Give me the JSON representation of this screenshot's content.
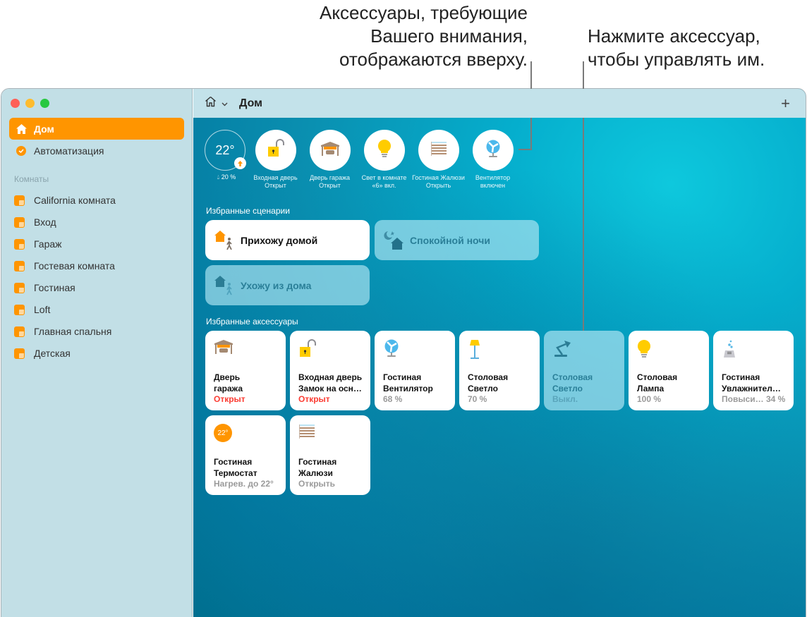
{
  "callouts": {
    "left": [
      "Аксессуары, требующие",
      "Вашего внимания,",
      "отображаются вверху."
    ],
    "right": [
      "Нажмите аксессуар,",
      "чтобы управлять им."
    ]
  },
  "sidebar": {
    "nav": [
      {
        "label": "Дом",
        "icon": "house-icon",
        "active": true
      },
      {
        "label": "Автоматизация",
        "icon": "clock-icon",
        "active": false
      }
    ],
    "rooms_label": "Комнаты",
    "rooms": [
      "California комната",
      "Вход",
      "Гараж",
      "Гостевая комната",
      "Гостиная",
      "Loft",
      "Главная спальня",
      "Детская"
    ]
  },
  "toolbar": {
    "title": "Дом",
    "add_label": "+"
  },
  "status": {
    "temperature": "22°",
    "humidity": "20 %",
    "tiles": [
      {
        "line1": "Входная дверь",
        "line2": "Открыт",
        "icon": "lock-open-icon"
      },
      {
        "line1": "Дверь гаража",
        "line2": "Открыт",
        "icon": "garage-icon"
      },
      {
        "line1": "Свет в комнате",
        "line2": "«6» вкл.",
        "icon": "lightbulb-icon"
      },
      {
        "line1": "Гостиная Жалюзи",
        "line2": "Открыть",
        "icon": "blinds-icon"
      },
      {
        "line1": "Вентилятор",
        "line2": "включен",
        "icon": "fan-icon"
      }
    ]
  },
  "scenes": {
    "heading": "Избранные сценарии",
    "items": [
      {
        "label": "Прихожу домой",
        "on": true
      },
      {
        "label": "Спокойной ночи",
        "on": false
      },
      {
        "label": "Ухожу из дома",
        "on": false
      }
    ]
  },
  "accessories": {
    "heading": "Избранные аксессуары",
    "items": [
      {
        "line1": "Дверь",
        "line2": "гаража",
        "state": "Открыт",
        "alert": true,
        "on": true,
        "icon": "garage-icon"
      },
      {
        "line1": "Входная дверь",
        "line2": "Замок на осн…",
        "state": "Открыт",
        "alert": true,
        "on": true,
        "icon": "lock-open-icon"
      },
      {
        "line1": "Гостиная",
        "line2": "Вентилятор",
        "state": "68 %",
        "alert": false,
        "on": true,
        "icon": "fan-icon"
      },
      {
        "line1": "Столовая",
        "line2": "Светло",
        "state": "70 %",
        "alert": false,
        "on": true,
        "icon": "floor-lamp-icon"
      },
      {
        "line1": "Столовая",
        "line2": "Светло",
        "state": "Выкл.",
        "alert": false,
        "on": false,
        "icon": "desk-lamp-icon"
      },
      {
        "line1": "Столовая",
        "line2": "Лампа",
        "state": "100 %",
        "alert": false,
        "on": true,
        "icon": "lightbulb-icon"
      },
      {
        "line1": "Гостиная",
        "line2": "Увлажнител…",
        "state": "Повыси… 34 %",
        "alert": false,
        "on": true,
        "icon": "humidifier-icon"
      },
      {
        "line1": "Гостиная",
        "line2": "Термостат",
        "state": "Нагрев. до 22°",
        "alert": false,
        "on": true,
        "icon": "thermostat-icon",
        "badge": "22°"
      },
      {
        "line1": "Гостиная",
        "line2": "Жалюзи",
        "state": "Открыть",
        "alert": false,
        "on": true,
        "icon": "blinds-icon"
      }
    ]
  },
  "colors": {
    "accent": "#ff9500",
    "alert": "#fb3c33",
    "sidebar_bg": "#c2dfe6",
    "toolbar_bg": "#c3e2ea"
  }
}
